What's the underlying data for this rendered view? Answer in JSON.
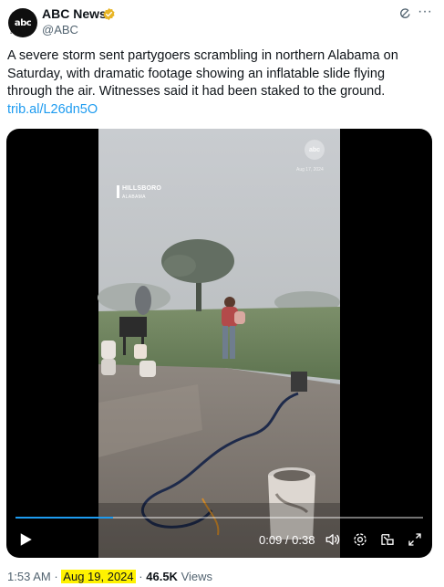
{
  "account": {
    "avatar_text": "abc",
    "avatar_sub": "NEWS",
    "display_name": "ABC News",
    "handle": "@ABC",
    "verified": true,
    "badge_color": "#e8b526"
  },
  "tweet": {
    "lines": [
      "A severe storm sent partygoers scrambling in northern Alabama on",
      "Saturday, with dramatic footage showing an inflatable slide flying",
      "through the air. Witnesses said it had been staked to the ground."
    ],
    "link": "trib.al/L26dn5O",
    "link_color": "#1d9bf0"
  },
  "video": {
    "location_city": "HILLSBORO",
    "location_state": "ALABAMA",
    "watermark_logo": "abc",
    "watermark_date": "Aug 17, 2024",
    "time_current": "0:09",
    "time_total": "0:38",
    "progress_fraction": 0.24
  },
  "footer": {
    "time": "1:53 AM",
    "separator": "·",
    "date": "Aug 19, 2024",
    "views_count": "46.5K",
    "views_label": "Views",
    "highlight_color": "#fff200"
  },
  "icons": [
    "verified-badge-icon",
    "grok-icon",
    "more-icon",
    "play-icon",
    "volume-icon",
    "settings-icon",
    "pip-icon",
    "fullscreen-icon",
    "location-pin-icon"
  ]
}
